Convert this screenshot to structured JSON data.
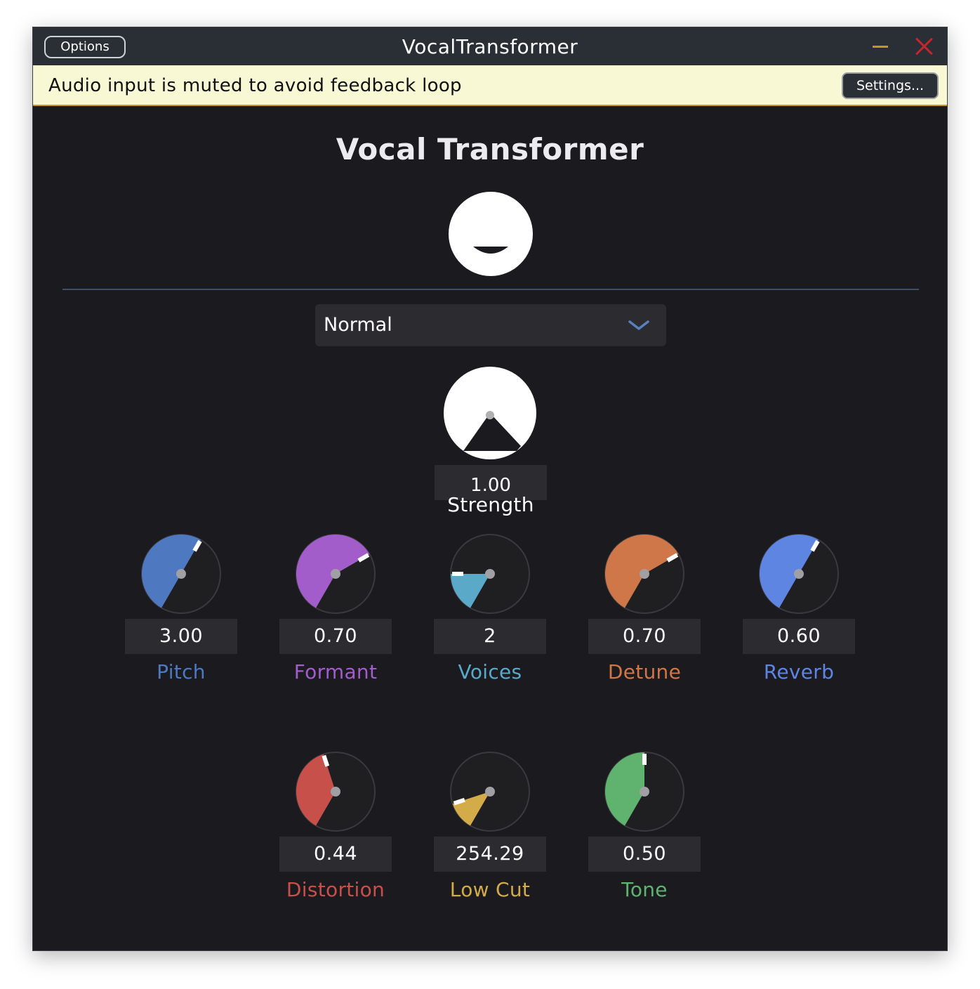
{
  "titlebar": {
    "options_label": "Options",
    "title": "VocalTransformer"
  },
  "notice": {
    "message": "Audio input is muted to avoid feedback loop",
    "settings_label": "Settings..."
  },
  "app": {
    "heading": "Vocal Transformer",
    "preset": "Normal",
    "strength": {
      "value": "1.00",
      "label": "Strength"
    }
  },
  "colors": {
    "background": "#1b1b1f",
    "field": "#2b2b30",
    "accent": "#5a7fbd"
  },
  "knobs": [
    {
      "name": "pitch",
      "label": "Pitch",
      "value": "3.00",
      "level": 0.6,
      "color": "#4e79c0"
    },
    {
      "name": "formant",
      "label": "Formant",
      "value": "0.70",
      "level": 0.7,
      "color": "#a35dcb"
    },
    {
      "name": "voices",
      "label": "Voices",
      "value": "2",
      "level": 0.2,
      "color": "#5aa9c9"
    },
    {
      "name": "detune",
      "label": "Detune",
      "value": "0.70",
      "level": 0.7,
      "color": "#cf7748"
    },
    {
      "name": "reverb",
      "label": "Reverb",
      "value": "0.60",
      "level": 0.6,
      "color": "#5f85e2"
    },
    {
      "name": "distortion",
      "label": "Distortion",
      "value": "0.44",
      "level": 0.44,
      "color": "#c8504a"
    },
    {
      "name": "low-cut",
      "label": "Low Cut",
      "value": "254.29",
      "level": 0.14,
      "color": "#d4ab49"
    },
    {
      "name": "tone",
      "label": "Tone",
      "value": "0.50",
      "level": 0.5,
      "color": "#5fb36f"
    }
  ]
}
